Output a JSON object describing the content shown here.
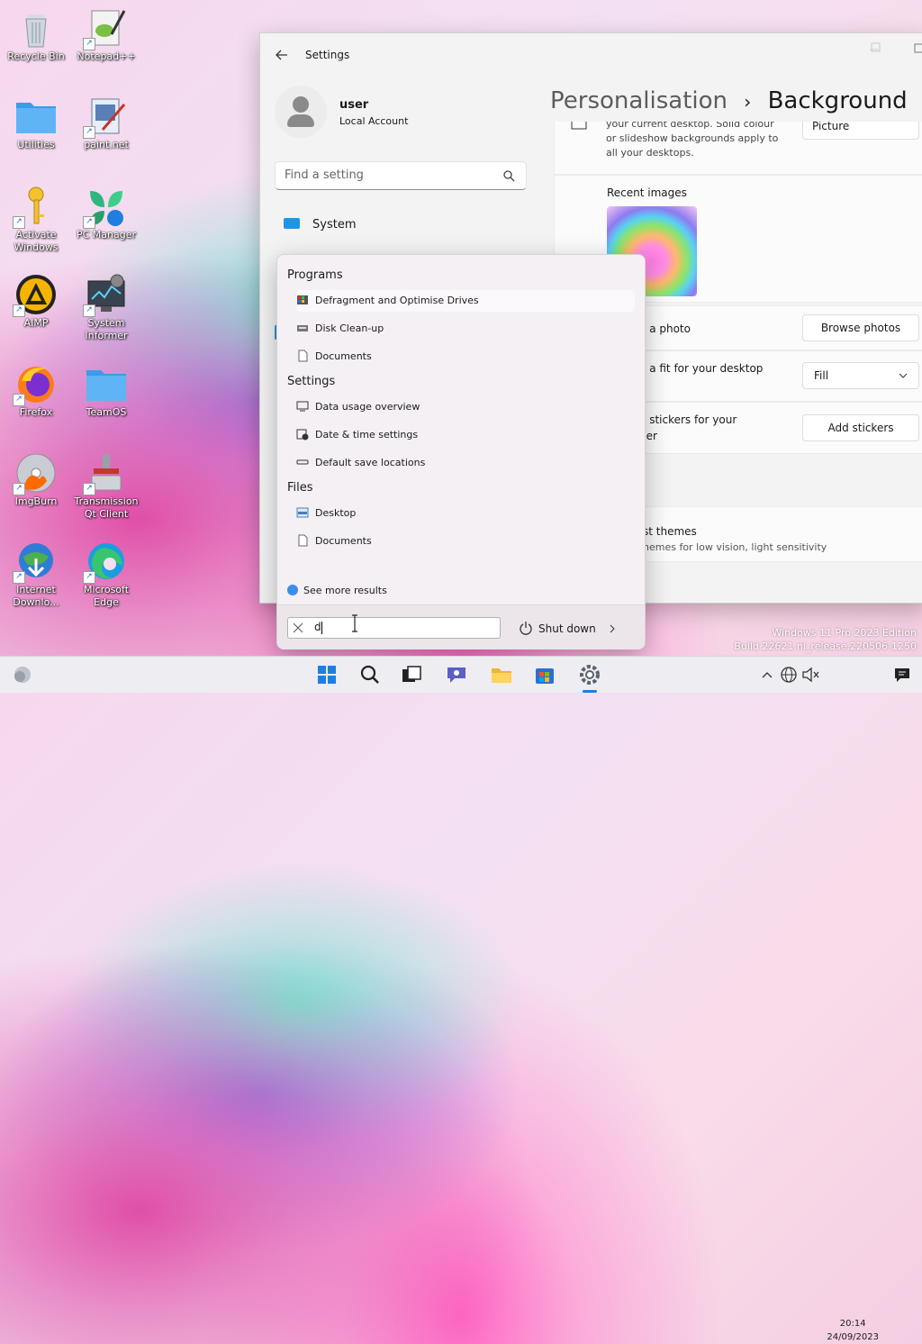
{
  "desktop": {
    "icons": [
      {
        "label": "Recycle Bin"
      },
      {
        "label": "Notepad++"
      },
      {
        "label": "Utilities"
      },
      {
        "label": "paint.net"
      },
      {
        "label": "Activate Windows"
      },
      {
        "label": "PC Manager"
      },
      {
        "label": "AIMP"
      },
      {
        "label": "System Informer"
      },
      {
        "label": "Firefox"
      },
      {
        "label": "TeamOS"
      },
      {
        "label": "ImgBurn"
      },
      {
        "label": "Transmission Qt Client"
      },
      {
        "label": "Internet Downlo..."
      },
      {
        "label": "Microsoft Edge"
      }
    ]
  },
  "settings": {
    "title": "Settings",
    "user": {
      "name": "user",
      "type": "Local Account"
    },
    "search_placeholder": "Find a setting",
    "nav_system": "System",
    "breadcrumb_parent": "Personalisation",
    "breadcrumb_sep": "›",
    "breadcrumb_current": "Background",
    "bg_desc_partial": "your current desktop. Solid colour or slideshow backgrounds apply to all your desktops.",
    "picture_dropdown": "Picture",
    "recent_images": "Recent images",
    "choose_photo_partial": "e a photo",
    "browse_photos": "Browse photos",
    "choose_fit_partial": "e a fit for your desktop",
    "fit_value": "Fill",
    "stickers_partial_1": "e stickers for your",
    "stickers_partial_2": "per",
    "add_stickers": "Add stickers",
    "contrast_title_partial": "st themes",
    "contrast_desc_partial": "hemes for low vision, light sensitivity"
  },
  "flyout": {
    "programs_header": "Programs",
    "programs": [
      "Defragment and Optimise Drives",
      "Disk Clean-up",
      "Documents"
    ],
    "settings_header": "Settings",
    "settings_items": [
      "Data usage overview",
      "Date & time settings",
      "Default save locations"
    ],
    "files_header": "Files",
    "files": [
      "Desktop",
      "Documents"
    ],
    "see_more": "See more results",
    "search_value": "d",
    "shutdown": "Shut down"
  },
  "watermark": {
    "line1": "Windows 11 Pro 2023 Edition",
    "line2": "Build 22621.ni_release.220506-1250"
  },
  "clock": {
    "time": "20:14",
    "date": "24/09/2023"
  },
  "colors": {
    "accent": "#1e96e6",
    "taskbar": "#ededf2"
  }
}
